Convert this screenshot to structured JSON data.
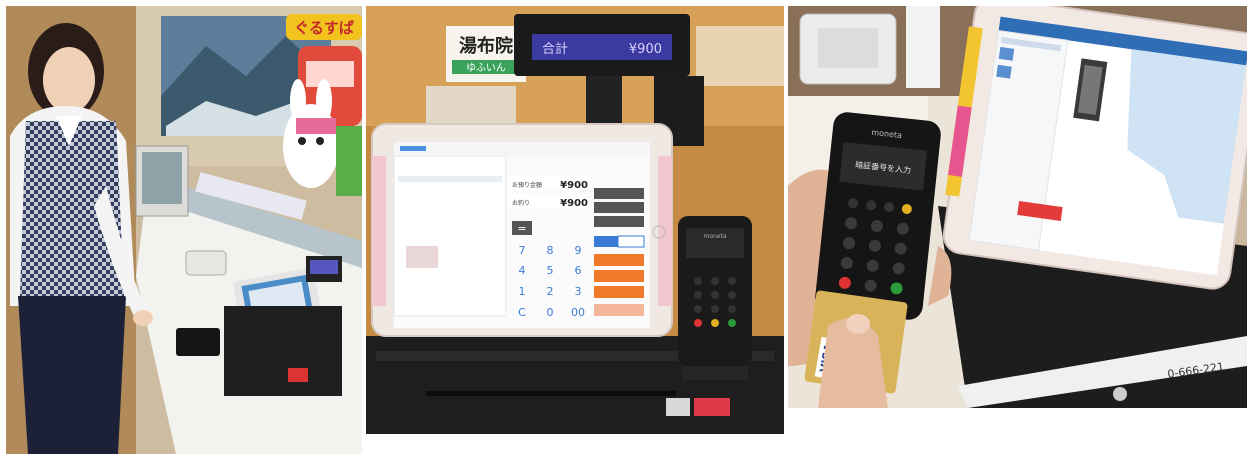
{
  "photos": [
    {
      "id": "photo-left",
      "sign_text": "ぐるすぱ"
    },
    {
      "id": "photo-center",
      "display_sign": "湯布院",
      "display_sign_sub": "ゆふいん",
      "customer_display": {
        "label": "合計",
        "amount": "¥900"
      },
      "tablet": {
        "rows": [
          {
            "label": "お預り金額",
            "value": "¥900"
          },
          {
            "label": "お釣り",
            "value": "¥900"
          }
        ],
        "equals_key": "=",
        "keypad": [
          "7",
          "8",
          "9",
          "4",
          "5",
          "6",
          "1",
          "2",
          "3",
          "C",
          "0",
          "00"
        ],
        "side_buttons": [
          "",
          "",
          ""
        ]
      },
      "reader_brand": "moneta"
    },
    {
      "id": "photo-right",
      "reader_brand": "moneta",
      "reader_screen_text": "暗証番号を入力",
      "card_brand": "VISA",
      "phone_number": "0-666-221"
    }
  ],
  "colors": {
    "accent_orange": "#f07a2a",
    "accent_pink": "#e6558f",
    "lcd_blue": "#3a3aa0",
    "lcd_text": "#d8d0ff",
    "key_red": "#d33",
    "key_green": "#2a9a3a",
    "key_yellow": "#e0b020"
  }
}
